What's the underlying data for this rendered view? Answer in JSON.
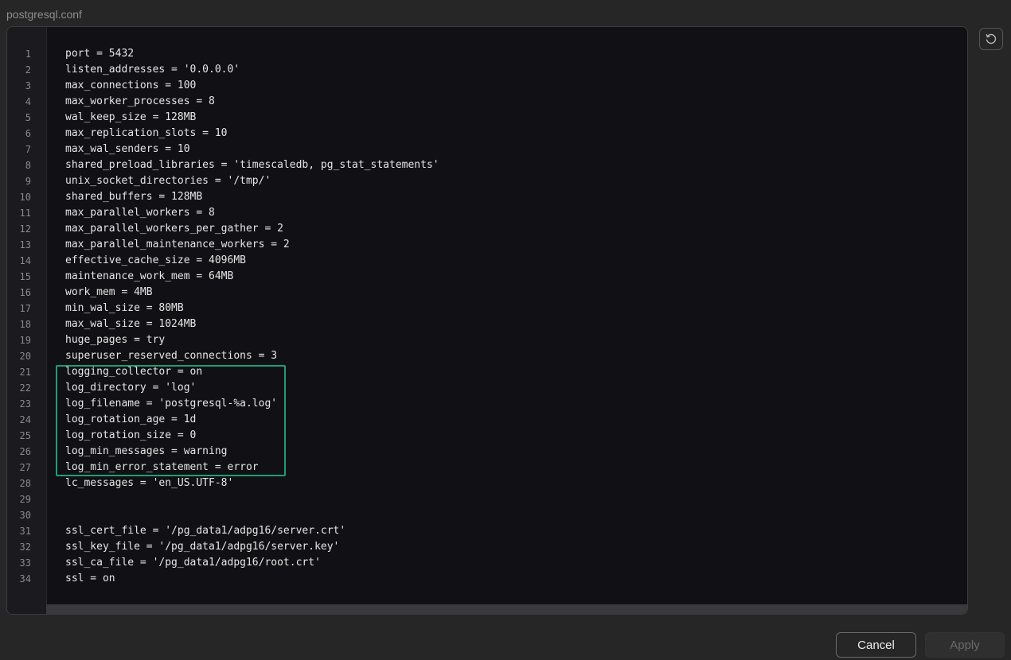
{
  "dialog": {
    "title": "postgresql.conf"
  },
  "editor": {
    "lines": [
      {
        "num": "1",
        "text": "port = 5432"
      },
      {
        "num": "2",
        "text": "listen_addresses = '0.0.0.0'"
      },
      {
        "num": "3",
        "text": "max_connections = 100"
      },
      {
        "num": "4",
        "text": "max_worker_processes = 8"
      },
      {
        "num": "5",
        "text": "wal_keep_size = 128MB"
      },
      {
        "num": "6",
        "text": "max_replication_slots = 10"
      },
      {
        "num": "7",
        "text": "max_wal_senders = 10"
      },
      {
        "num": "8",
        "text": "shared_preload_libraries = 'timescaledb, pg_stat_statements'"
      },
      {
        "num": "9",
        "text": "unix_socket_directories = '/tmp/'"
      },
      {
        "num": "10",
        "text": "shared_buffers = 128MB"
      },
      {
        "num": "11",
        "text": "max_parallel_workers = 8"
      },
      {
        "num": "12",
        "text": "max_parallel_workers_per_gather = 2"
      },
      {
        "num": "13",
        "text": "max_parallel_maintenance_workers = 2"
      },
      {
        "num": "14",
        "text": "effective_cache_size = 4096MB"
      },
      {
        "num": "15",
        "text": "maintenance_work_mem = 64MB"
      },
      {
        "num": "16",
        "text": "work_mem = 4MB"
      },
      {
        "num": "17",
        "text": "min_wal_size = 80MB"
      },
      {
        "num": "18",
        "text": "max_wal_size = 1024MB"
      },
      {
        "num": "19",
        "text": "huge_pages = try"
      },
      {
        "num": "20",
        "text": "superuser_reserved_connections = 3"
      },
      {
        "num": "21",
        "text": "logging_collector = on"
      },
      {
        "num": "22",
        "text": "log_directory = 'log'"
      },
      {
        "num": "23",
        "text": "log_filename = 'postgresql-%a.log'"
      },
      {
        "num": "24",
        "text": "log_rotation_age = 1d"
      },
      {
        "num": "25",
        "text": "log_rotation_size = 0"
      },
      {
        "num": "26",
        "text": "log_min_messages = warning"
      },
      {
        "num": "27",
        "text": "log_min_error_statement = error"
      },
      {
        "num": "28",
        "text": "lc_messages = 'en_US.UTF-8'"
      },
      {
        "num": "29",
        "text": ""
      },
      {
        "num": "30",
        "text": ""
      },
      {
        "num": "31",
        "text": "ssl_cert_file = '/pg_data1/adpg16/server.crt'"
      },
      {
        "num": "32",
        "text": "ssl_key_file = '/pg_data1/adpg16/server.key'"
      },
      {
        "num": "33",
        "text": "ssl_ca_file = '/pg_data1/adpg16/root.crt'"
      },
      {
        "num": "34",
        "text": "ssl = on"
      }
    ],
    "highlight_color": "#1f9e72"
  },
  "toolbar": {
    "reset_icon": "reset-icon"
  },
  "footer": {
    "cancel_label": "Cancel",
    "apply_label": "Apply"
  }
}
